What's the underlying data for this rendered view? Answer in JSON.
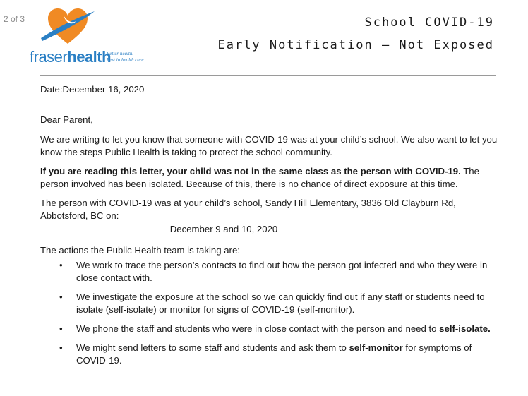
{
  "viewer": {
    "page_indicator": "2 of 3"
  },
  "logo": {
    "brand_part1": "fraser",
    "brand_part2": "health",
    "tagline_line1": "Better health.",
    "tagline_line2": "Best in health care.",
    "colors": {
      "blue": "#2a7fc4",
      "orange": "#f08a24"
    }
  },
  "header": {
    "title_line1": "School COVID-19",
    "title_line2": "Early Notification – Not Exposed"
  },
  "letter": {
    "date": "Date:December 16, 2020",
    "salutation": "Dear Parent,",
    "intro": "We are writing to let you know that someone with COVID-19 was at your child’s school. We also want to let you know the steps Public Health is taking to protect the school community.",
    "notice_bold": "If you are reading this letter, your child was not in the same class as the person with COVID-19.",
    "notice_rest": " The person involved has been isolated. Because of this, there is no chance of direct exposure at this time.",
    "location": "The person with COVID-19 was at your child’s school, Sandy Hill Elementary, 3836 Old Clayburn Rd, Abbotsford, BC on:",
    "exposure_dates": "December 9 and 10, 2020",
    "actions_intro": "The actions the Public Health team is taking are:",
    "actions": [
      {
        "text_before": "We work to trace the person’s contacts to find out how the person got infected and who they were in close contact with.",
        "text_bold": "",
        "text_after": ""
      },
      {
        "text_before": "We investigate the exposure at the school so we can quickly find out if any staff or students need to isolate (self-isolate) or monitor for signs of COVID-19 (self-monitor).",
        "text_bold": "",
        "text_after": ""
      },
      {
        "text_before": "We phone the staff and students who were in close contact with the person and need to ",
        "text_bold": "self-isolate.",
        "text_after": ""
      },
      {
        "text_before": "We might send letters to some staff and students and ask them to ",
        "text_bold": "self-monitor",
        "text_after": " for symptoms of COVID-19."
      }
    ],
    "bullet_glyph": "•"
  }
}
